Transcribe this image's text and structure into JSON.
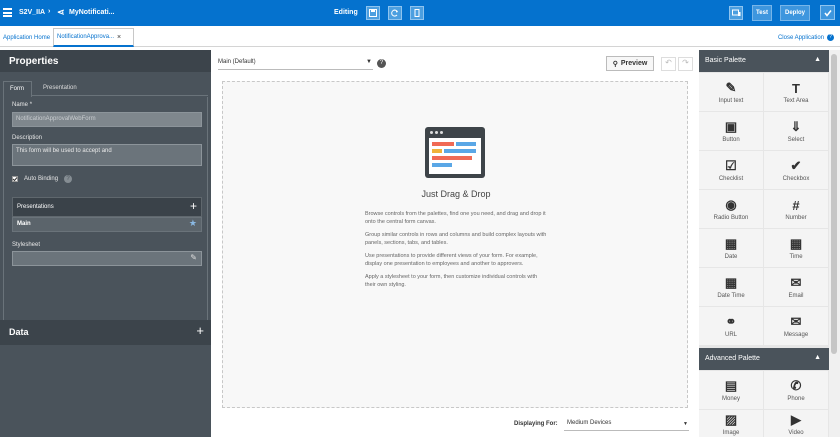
{
  "topbar": {
    "app": "S2V_IIA",
    "breadcrumb": "MyNotificati...",
    "mode": "Editing",
    "test": "Test",
    "deploy": "Deploy"
  },
  "tabs": {
    "home": "Application Home",
    "active": "NotificationApprova...",
    "close_tab": "×",
    "close_app": "Close Application"
  },
  "properties": {
    "title": "Properties",
    "tab_form": "Form",
    "tab_presentation": "Presentation",
    "name_label": "Name",
    "name_required": "*",
    "name_value": "NotificationApprovalWebForm",
    "desc_label": "Description",
    "desc_value": "This form will be used to accept and",
    "auto_binding": "Auto Binding",
    "presentations": "Presentations",
    "main": "Main",
    "stylesheet": "Stylesheet",
    "data": "Data"
  },
  "canvas": {
    "presentation_select": "Main (Default)",
    "preview": "Preview",
    "title": "Just Drag & Drop",
    "p1": "Browse controls from the palettes, find one you need, and drag and drop it onto the central form canvas.",
    "p2": "Group similar controls in rows and columns and build complex layouts with panels, sections, tabs, and tables.",
    "p3": "Use presentations to provide different views of your form. For example, display one presentation to employees and another to approvers.",
    "p4": "Apply a stylesheet to your form, then customize individual controls with their own styling.",
    "displaying_for": "Displaying For:",
    "device": "Medium Devices"
  },
  "palette": {
    "basic": "Basic Palette",
    "advanced": "Advanced Palette",
    "basic_items": [
      "Input text",
      "Text Area",
      "Button",
      "Select",
      "Checklist",
      "Checkbox",
      "Radio Button",
      "Number",
      "Date",
      "Time",
      "Date Time",
      "Email",
      "URL",
      "Message"
    ],
    "advanced_items": [
      "Money",
      "Phone",
      "Image",
      "Video"
    ]
  }
}
